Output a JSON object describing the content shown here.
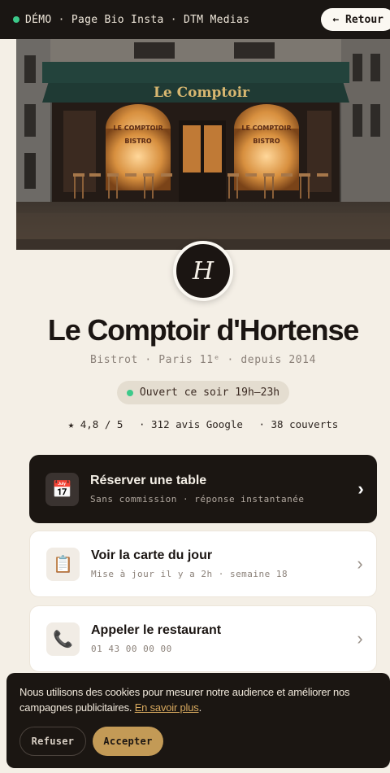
{
  "topbar": {
    "title": "DÉMO · Page Bio Insta · DTM Medias",
    "back_label": "← Retour"
  },
  "hero": {
    "sign_text": "Le Comptoir",
    "window_label_1": "LE COMPTOIR",
    "window_label_2": "BISTRO"
  },
  "profile": {
    "monogram": "H",
    "name": "Le Comptoir d'Hortense",
    "subtitle": "Bistrot · Paris 11ᵉ · depuis 2014",
    "status": "Ouvert ce soir 19h–23h",
    "rating": "★ 4,8 / 5",
    "reviews": "· 312 avis Google",
    "covers": "· 38 couverts"
  },
  "actions": [
    {
      "icon": "calendar-icon",
      "emoji": "📅",
      "title": "Réserver une table",
      "subtitle": "Sans commission · réponse instantanée"
    },
    {
      "icon": "clipboard-icon",
      "emoji": "📋",
      "title": "Voir la carte du jour",
      "subtitle": "Mise à jour il y a 2h · semaine 18"
    },
    {
      "icon": "phone-icon",
      "emoji": "📞",
      "title": "Appeler le restaurant",
      "subtitle": "01 43 00 00 00"
    }
  ],
  "cookie": {
    "text": "Nous utilisons des cookies pour mesurer notre audience et améliorer nos campagnes publicitaires.",
    "link": "En savoir plus",
    "after_link": ".",
    "refuse": "Refuser",
    "accept": "Accepter"
  },
  "colors": {
    "background": "#f4efe6",
    "dark": "#1b1612",
    "accent": "#c39a56",
    "status_green": "#3cc98a"
  }
}
